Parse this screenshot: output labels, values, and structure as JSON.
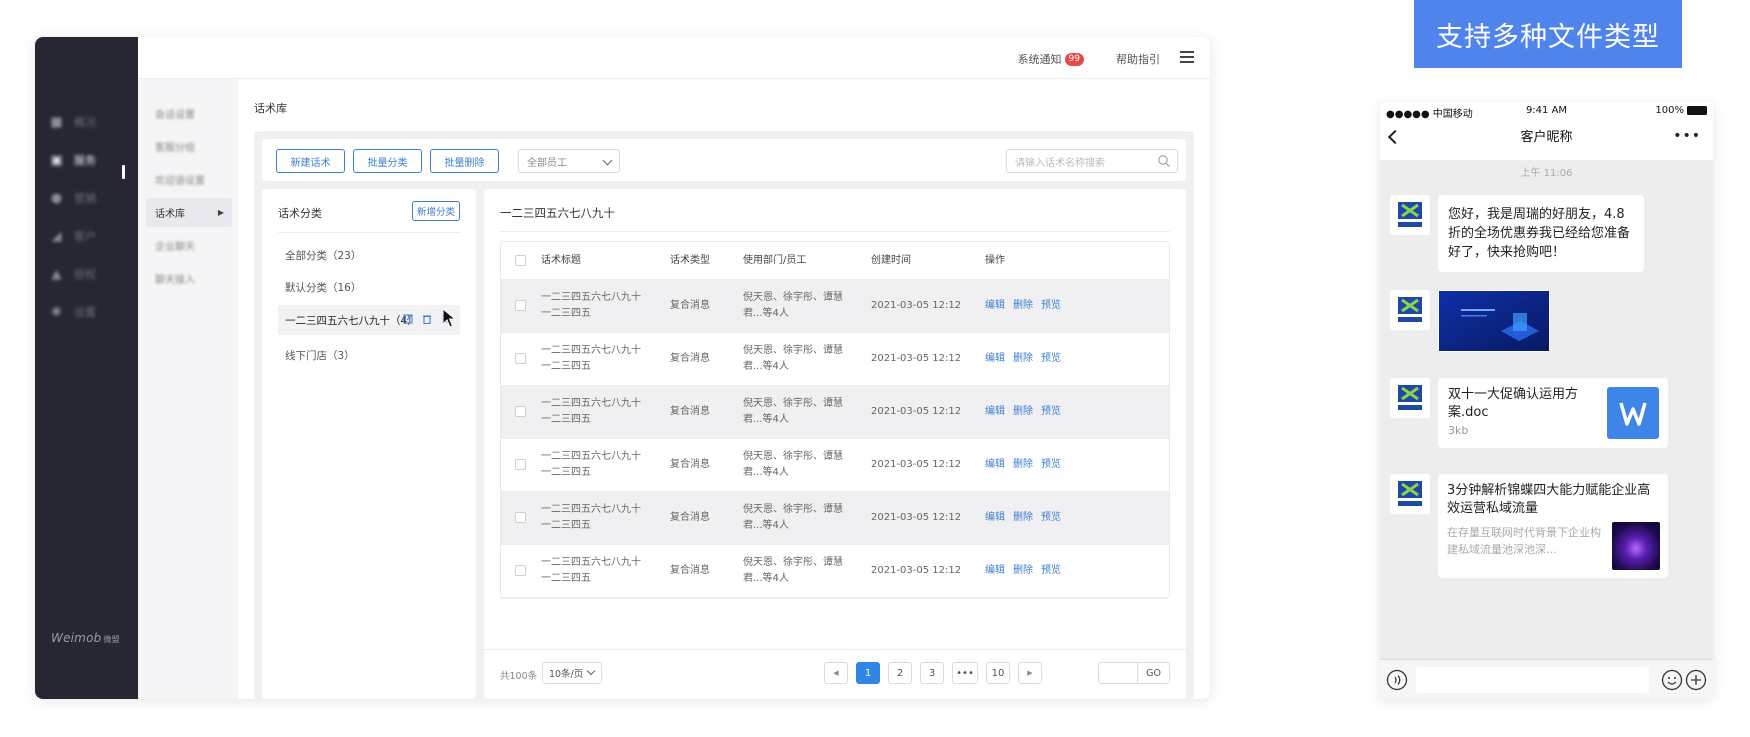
{
  "nav": {
    "items": [
      {
        "label": "概况",
        "icon": "home-icon"
      },
      {
        "label": "服务",
        "icon": "service-icon"
      },
      {
        "label": "营销",
        "icon": "user-icon"
      },
      {
        "label": "客户",
        "icon": "chart-icon"
      },
      {
        "label": "授权",
        "icon": "shield-icon"
      },
      {
        "label": "设置",
        "icon": "gear-icon"
      }
    ],
    "brand": "Weimob",
    "brand_sub": "微盟"
  },
  "topbar": {
    "notify_label": "系统通知",
    "notify_count": "99",
    "help_label": "帮助指引"
  },
  "subnav": {
    "items": [
      "会话设置",
      "客服分组",
      "欢迎语设置",
      "话术库",
      "企业聊天",
      "聊天接入"
    ]
  },
  "page": {
    "title": "话术库"
  },
  "toolbar": {
    "new_label": "新建话术",
    "batch_category_label": "批量分类",
    "batch_delete_label": "批量删除",
    "employee_select": "全部员工",
    "search_placeholder": "请输入话术名称搜索"
  },
  "categories": {
    "title": "话术分类",
    "add_label": "新增分类",
    "items": [
      {
        "label": "全部分类（23）"
      },
      {
        "label": "默认分类（16）"
      },
      {
        "label": "一二三四五六七八九十（4）"
      },
      {
        "label": "线下门店（3）"
      }
    ]
  },
  "list": {
    "title": "一二三四五六七八九十",
    "headers": {
      "title": "话术标题",
      "type": "话术类型",
      "users": "使用部门/员工",
      "created": "创建时间",
      "ops": "操作"
    },
    "rows": [
      {
        "title1": "一二三四五六七八九十",
        "title2": "一二三四五",
        "type": "复合消息",
        "users1": "倪天恩、徐宇彤、谭慧",
        "users2": "君...等4人",
        "created": "2021-03-05 12:12"
      },
      {
        "title1": "一二三四五六七八九十",
        "title2": "一二三四五",
        "type": "复合消息",
        "users1": "倪天恩、徐宇彤、谭慧",
        "users2": "君...等4人",
        "created": "2021-03-05 12:12"
      },
      {
        "title1": "一二三四五六七八九十",
        "title2": "一二三四五",
        "type": "复合消息",
        "users1": "倪天恩、徐宇彤、谭慧",
        "users2": "君...等4人",
        "created": "2021-03-05 12:12"
      },
      {
        "title1": "一二三四五六七八九十",
        "title2": "一二三四五",
        "type": "复合消息",
        "users1": "倪天恩、徐宇彤、谭慧",
        "users2": "君...等4人",
        "created": "2021-03-05 12:12"
      },
      {
        "title1": "一二三四五六七八九十",
        "title2": "一二三四五",
        "type": "复合消息",
        "users1": "倪天恩、徐宇彤、谭慧",
        "users2": "君...等4人",
        "created": "2021-03-05 12:12"
      },
      {
        "title1": "一二三四五六七八九十",
        "title2": "一二三四五",
        "type": "复合消息",
        "users1": "倪天恩、徐宇彤、谭慧",
        "users2": "君...等4人",
        "created": "2021-03-05 12:12"
      }
    ],
    "ops": {
      "edit": "编辑",
      "delete": "删除",
      "preview": "预览"
    }
  },
  "pagination": {
    "total": "共100条",
    "page_size": "10条/页",
    "pages": [
      "1",
      "2",
      "3",
      "•••",
      "10"
    ],
    "current": "1",
    "go_label": "GO"
  },
  "banner": {
    "text": "支持多种文件类型"
  },
  "phone": {
    "carrier": "●●●●● 中国移动",
    "time": "9:41 AM",
    "battery": "100%",
    "chat_title": "客户昵称",
    "timestamp": "上午 11:06",
    "message_text": "您好，我是周瑞的好朋友，4.8折的全场优惠券我已经给您准备好了，快来抢购吧！",
    "file_name": "双十一大促确认运用方案.doc",
    "file_size": "3kb",
    "article_title": "3分钟解析锦蝶四大能力赋能企业高效运营私域流量",
    "article_desc": "在存量互联网时代背景下企业构建私域流量池深池深..."
  },
  "colors": {
    "accent": "#3d7fd6",
    "banner": "#4f84ec",
    "nav_bg": "#262733",
    "badge": "#e84a4a"
  }
}
